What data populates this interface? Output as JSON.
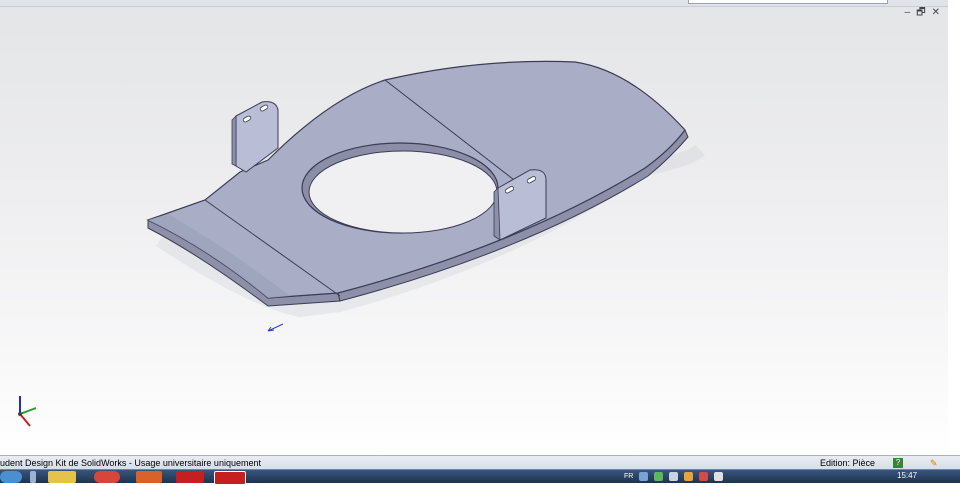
{
  "window": {
    "controls": [
      "–",
      "🗗",
      "✕"
    ]
  },
  "statusbar": {
    "left_text": "udent Design Kit de SolidWorks - Usage universitaire uniquement",
    "mode": "Edition: Pièce",
    "help_label": "?",
    "pencil_icon": "pencil-icon"
  },
  "taskbar": {
    "tray_language": "FR",
    "clock": "15:47"
  },
  "colors": {
    "part_face": "#a9adc6",
    "part_edge": "#3b3d55",
    "bracket_face": "#b9bdd6",
    "accent": "#2f8a2f"
  }
}
